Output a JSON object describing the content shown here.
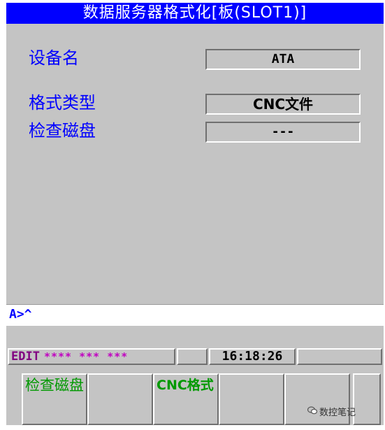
{
  "title": "数据服务器格式化[板(SLOT1)]",
  "fields": [
    {
      "label": "设备名",
      "value": "ATA"
    },
    {
      "label": "格式类型",
      "value": "CNC文件"
    },
    {
      "label": "检查磁盘",
      "value": "---"
    }
  ],
  "input_prompt": "A>^",
  "status": {
    "mode": "EDIT",
    "stars": "**** *** ***",
    "time": "16:18:26"
  },
  "softkeys": [
    "检查磁盘",
    "",
    "CNC格式",
    "",
    "",
    ""
  ],
  "watermark": "数控笔记",
  "colors": {
    "title_bg": "#0000ff",
    "label": "#0000ff",
    "softkey_text": "#009900",
    "mode_text": "#800080",
    "panel_bg": "#c4c4c4"
  }
}
